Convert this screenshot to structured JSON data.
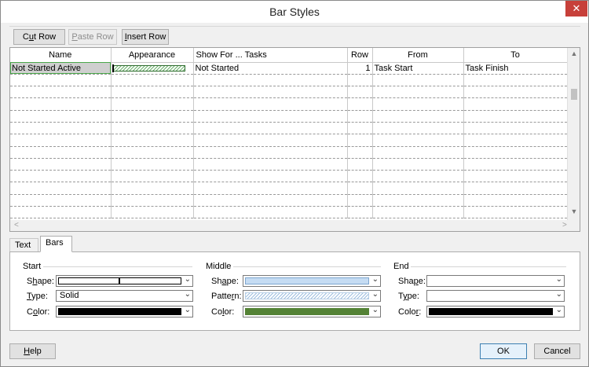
{
  "window": {
    "title": "Bar Styles",
    "close_glyph": "✕"
  },
  "toolbar": {
    "cut_row": {
      "pre": "C",
      "u": "u",
      "post": "t Row"
    },
    "paste_row": {
      "pre": "",
      "u": "P",
      "post": "aste Row"
    },
    "insert_row": {
      "pre": "",
      "u": "I",
      "post": "nsert Row"
    }
  },
  "table": {
    "columns": [
      "Name",
      "Appearance",
      "Show For ... Tasks",
      "Row",
      "From",
      "To"
    ],
    "rows": [
      {
        "name": "Not Started Active",
        "appearance": "green-hatched-bar",
        "show_for": "Not Started",
        "row": "1",
        "from": "Task Start",
        "to": "Task Finish"
      }
    ]
  },
  "tabs": {
    "text": "Text",
    "bars": "Bars",
    "active": "Bars"
  },
  "bars": {
    "start": {
      "heading": "Start",
      "shape_label": {
        "pre": "S",
        "u": "h",
        "post": "ape:"
      },
      "type_label": {
        "pre": "",
        "u": "T",
        "post": "ype:"
      },
      "color_label": {
        "pre": "C",
        "u": "o",
        "post": "lor:"
      },
      "type_value": "Solid",
      "color_value": "#000000"
    },
    "middle": {
      "heading": "Middle",
      "shape_label": {
        "pre": "Sh",
        "u": "a",
        "post": "pe:"
      },
      "pattern_label": {
        "pre": "Patte",
        "u": "r",
        "post": "n:"
      },
      "color_label": {
        "pre": "Co",
        "u": "l",
        "post": "or:"
      },
      "shape_color": "#c5dcf3",
      "color_value": "#548235"
    },
    "end": {
      "heading": "End",
      "shape_label": {
        "pre": "Sha",
        "u": "p",
        "post": "e:"
      },
      "type_label": {
        "pre": "T",
        "u": "y",
        "post": "pe:"
      },
      "color_label": {
        "pre": "Colo",
        "u": "r",
        "post": ":"
      },
      "color_value": "#000000"
    }
  },
  "footer": {
    "help": {
      "pre": "",
      "u": "H",
      "post": "elp"
    },
    "ok": "OK",
    "cancel": "Cancel"
  },
  "icons": {
    "dropdown": "chevron-down-icon",
    "scroll_up": "▲",
    "scroll_down": "▼",
    "scroll_left": "<",
    "scroll_right": ">"
  }
}
